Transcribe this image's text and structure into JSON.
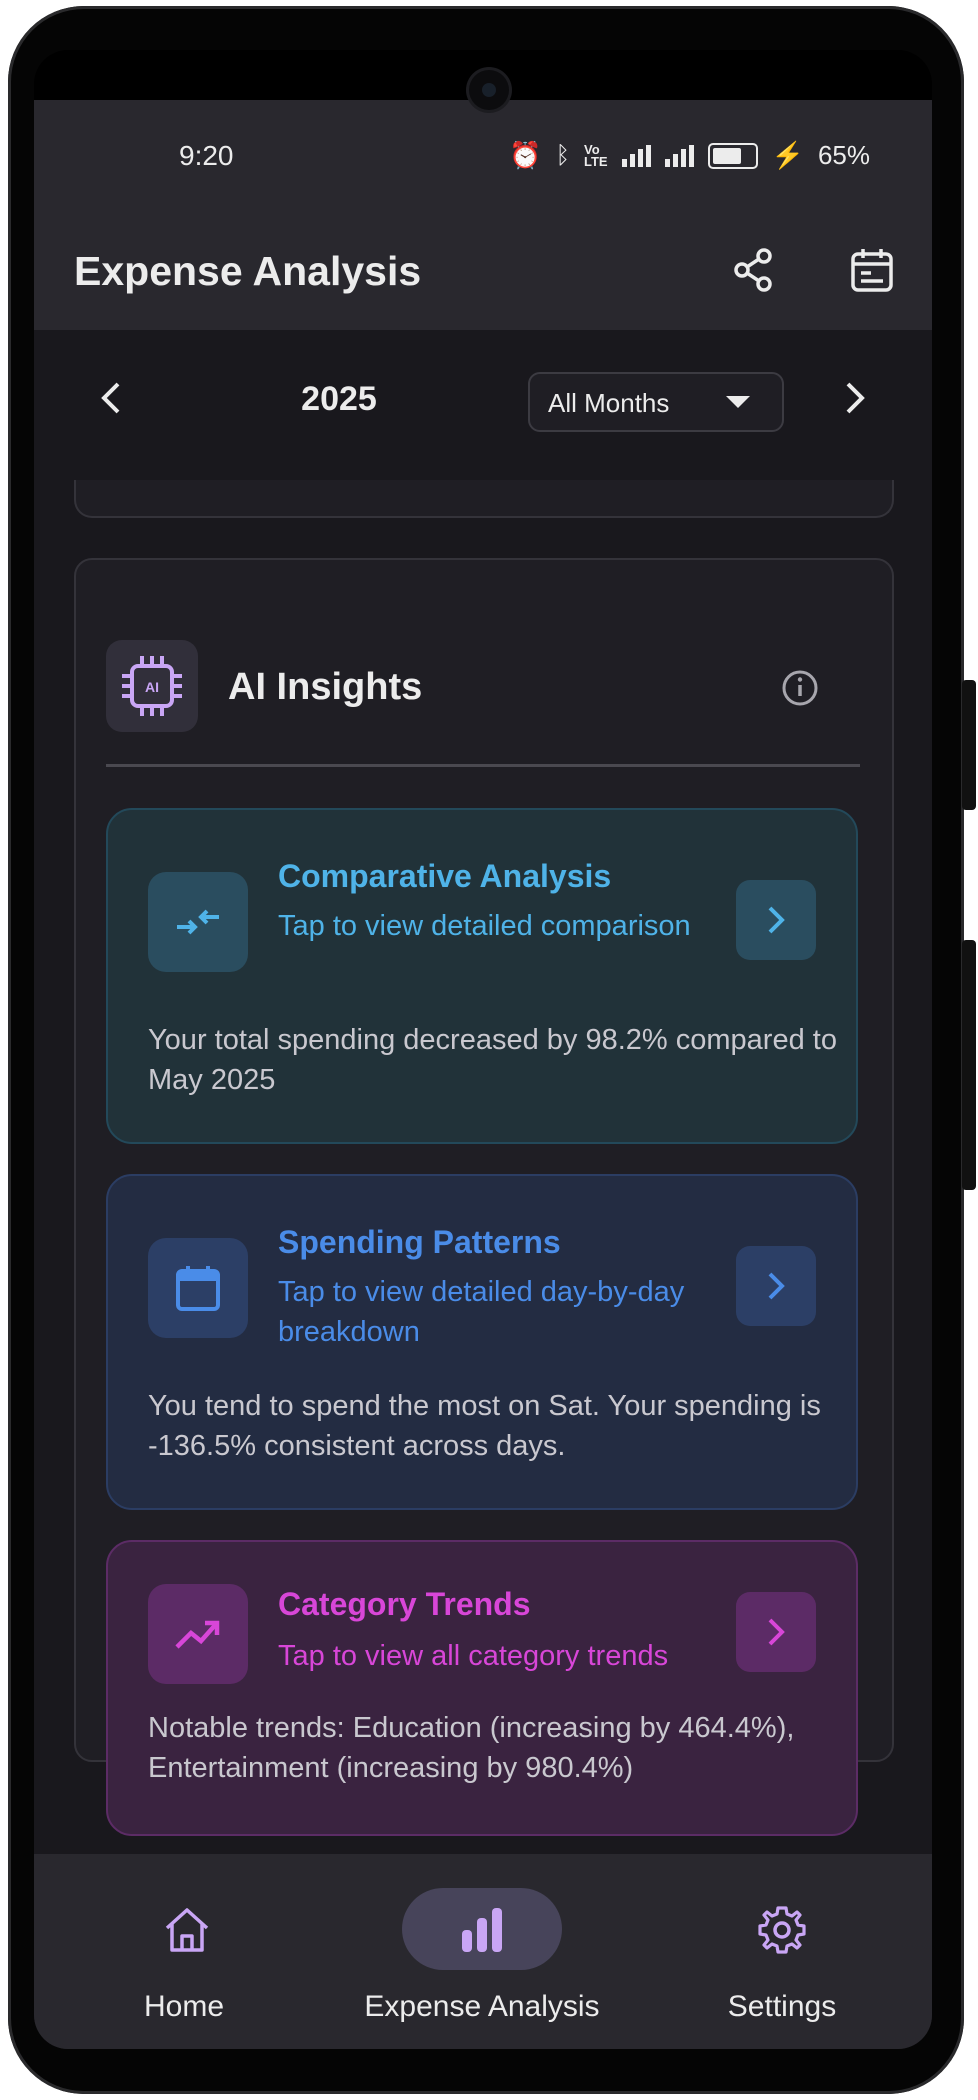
{
  "status_bar": {
    "time": "9:20",
    "battery": "65%"
  },
  "app_bar": {
    "title": "Expense Analysis",
    "icons": [
      "share-icon",
      "calendar-icon"
    ]
  },
  "period": {
    "year": "2025",
    "month_filter": "All Months"
  },
  "ai_insights": {
    "title": "AI Insights",
    "cards": [
      {
        "title": "Comparative Analysis",
        "subtitle": "Tap to view detailed comparison",
        "body": "Your total spending decreased by 98.2% compared to May 2025",
        "color": "#4fb3e8",
        "icon": "compare-arrows-icon"
      },
      {
        "title": "Spending Patterns",
        "subtitle": "Tap to view detailed day-by-day breakdown",
        "body": "You tend to spend the most on Sat. Your spending is -136.5% consistent across days.",
        "color": "#4a8ce8",
        "icon": "calendar-icon"
      },
      {
        "title": "Category Trends",
        "subtitle": "Tap to view all category trends",
        "body": "Notable trends: Education (increasing by 464.4%), Entertainment (increasing by 980.4%)",
        "color": "#d846d8",
        "icon": "trending-up-icon"
      }
    ]
  },
  "bottom_nav": {
    "items": [
      {
        "label": "Home",
        "icon": "home-icon"
      },
      {
        "label": "Expense Analysis",
        "icon": "bar-chart-icon",
        "active": true
      },
      {
        "label": "Settings",
        "icon": "gear-icon"
      }
    ]
  }
}
